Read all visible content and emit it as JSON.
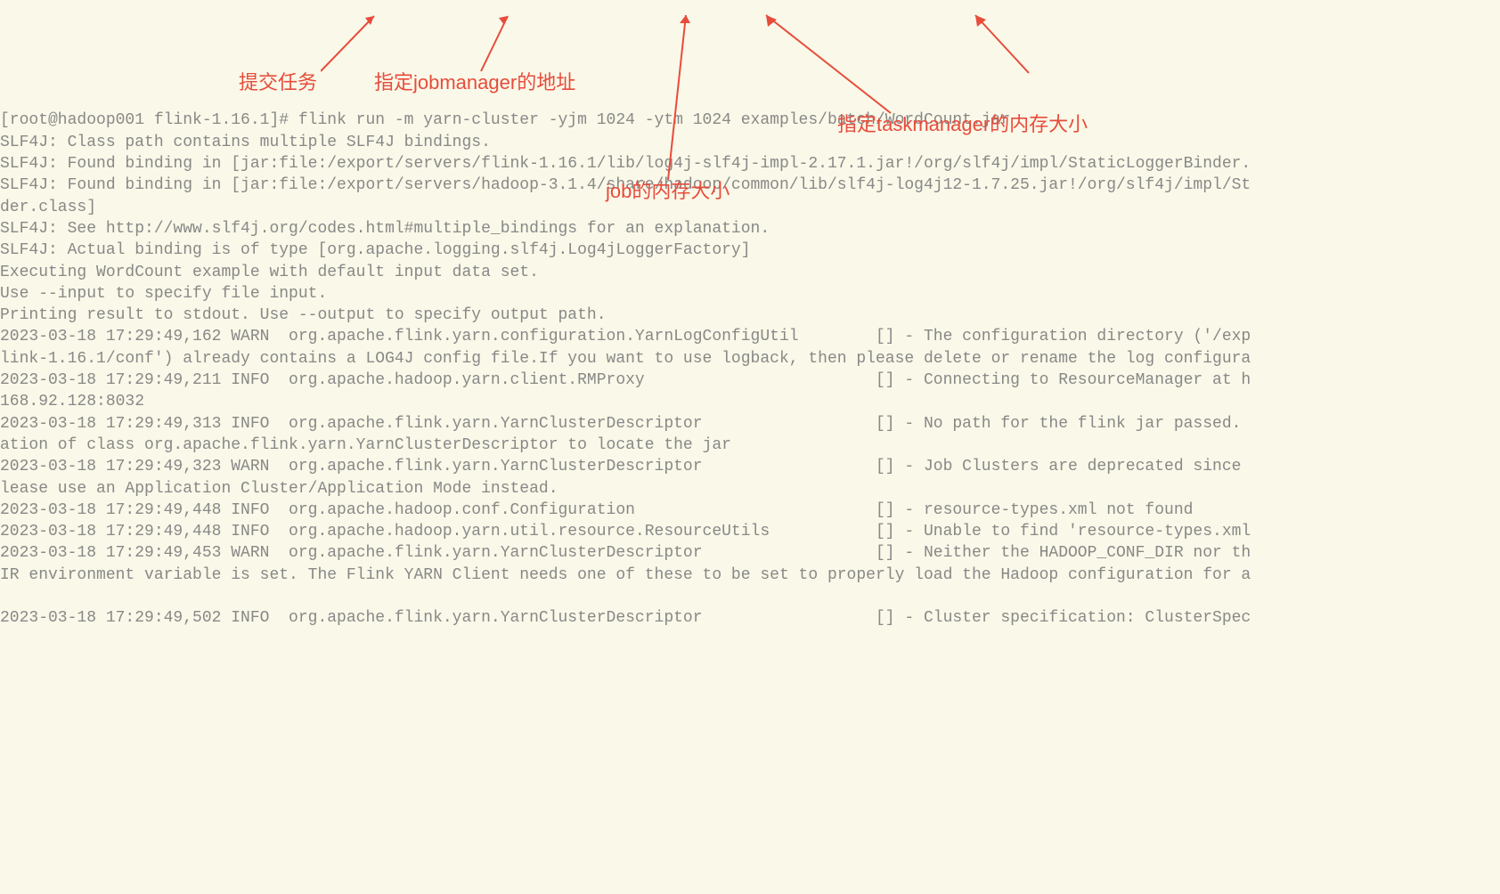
{
  "terminal": {
    "prompt": "[root@hadoop001 flink-1.16.1]# ",
    "command": "flink run -m yarn-cluster -yjm 1024 -ytm 1024 examples/batch/WordCount.jar",
    "lines": [
      "SLF4J: Class path contains multiple SLF4J bindings.",
      "SLF4J: Found binding in [jar:file:/export/servers/flink-1.16.1/lib/log4j-slf4j-impl-2.17.1.jar!/org/slf4j/impl/StaticLoggerBinder.",
      "SLF4J: Found binding in [jar:file:/export/servers/hadoop-3.1.4/share/hadoop/common/lib/slf4j-log4j12-1.7.25.jar!/org/slf4j/impl/St",
      "der.class]",
      "SLF4J: See http://www.slf4j.org/codes.html#multiple_bindings for an explanation.",
      "SLF4J: Actual binding is of type [org.apache.logging.slf4j.Log4jLoggerFactory]",
      "Executing WordCount example with default input data set.",
      "Use --input to specify file input.",
      "Printing result to stdout. Use --output to specify output path.",
      "2023-03-18 17:29:49,162 WARN  org.apache.flink.yarn.configuration.YarnLogConfigUtil        [] - The configuration directory ('/exp",
      "link-1.16.1/conf') already contains a LOG4J config file.If you want to use logback, then please delete or rename the log configura",
      "2023-03-18 17:29:49,211 INFO  org.apache.hadoop.yarn.client.RMProxy                        [] - Connecting to ResourceManager at h",
      "168.92.128:8032",
      "2023-03-18 17:29:49,313 INFO  org.apache.flink.yarn.YarnClusterDescriptor                  [] - No path for the flink jar passed.",
      "ation of class org.apache.flink.yarn.YarnClusterDescriptor to locate the jar",
      "2023-03-18 17:29:49,323 WARN  org.apache.flink.yarn.YarnClusterDescriptor                  [] - Job Clusters are deprecated since",
      "lease use an Application Cluster/Application Mode instead.",
      "2023-03-18 17:29:49,448 INFO  org.apache.hadoop.conf.Configuration                         [] - resource-types.xml not found",
      "2023-03-18 17:29:49,448 INFO  org.apache.hadoop.yarn.util.resource.ResourceUtils           [] - Unable to find 'resource-types.xml",
      "2023-03-18 17:29:49,453 WARN  org.apache.flink.yarn.YarnClusterDescriptor                  [] - Neither the HADOOP_CONF_DIR nor th",
      "IR environment variable is set. The Flink YARN Client needs one of these to be set to properly load the Hadoop configuration for a",
      "",
      "2023-03-18 17:29:49,502 INFO  org.apache.flink.yarn.YarnClusterDescriptor                  [] - Cluster specification: ClusterSpec"
    ]
  },
  "annotations": {
    "submit_task": "提交任务",
    "jobmanager_addr": "指定jobmanager的地址",
    "job_memory": "job的内存大小",
    "taskmanager_memory": "指定taskmanager的内存大小"
  }
}
